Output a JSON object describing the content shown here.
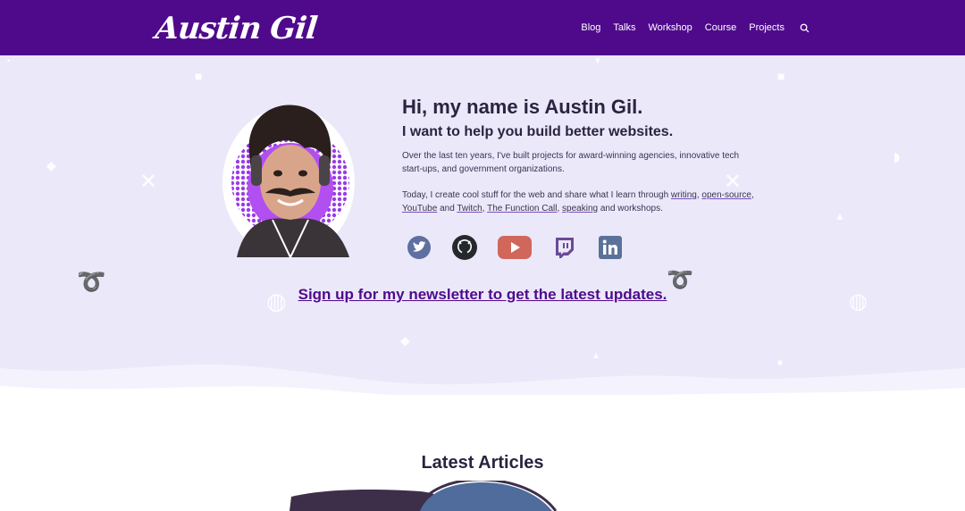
{
  "header": {
    "logo": "Austin Gil",
    "nav": [
      "Blog",
      "Talks",
      "Workshop",
      "Course",
      "Projects"
    ],
    "search_icon": "search-icon"
  },
  "hero": {
    "title": "Hi, my name is Austin Gil.",
    "subtitle": "I want to help you build better websites.",
    "intro": "Over the last ten years, I've built projects for award-winning agencies, innovative tech start-ups, and government organizations.",
    "today_prefix": "Today, I create cool stuff for the web and share what I learn through ",
    "links": {
      "writing": "writing",
      "open_source": "open-source",
      "youtube": "YouTube",
      "twitch": "Twitch",
      "function_call": "The Function Call",
      "speaking": "speaking"
    },
    "sep_comma": ", ",
    "and_word": " and ",
    "suffix": " and workshops.",
    "socials": [
      "twitter-icon",
      "github-icon",
      "youtube-icon",
      "twitch-icon",
      "linkedin-icon"
    ],
    "newsletter": "Sign up for my newsletter to get the latest updates."
  },
  "latest": {
    "heading": "Latest Articles"
  },
  "colors": {
    "header_bg": "#4f0a8c",
    "hero_bg": "#ebe8fa",
    "accent": "#9b3be8"
  }
}
